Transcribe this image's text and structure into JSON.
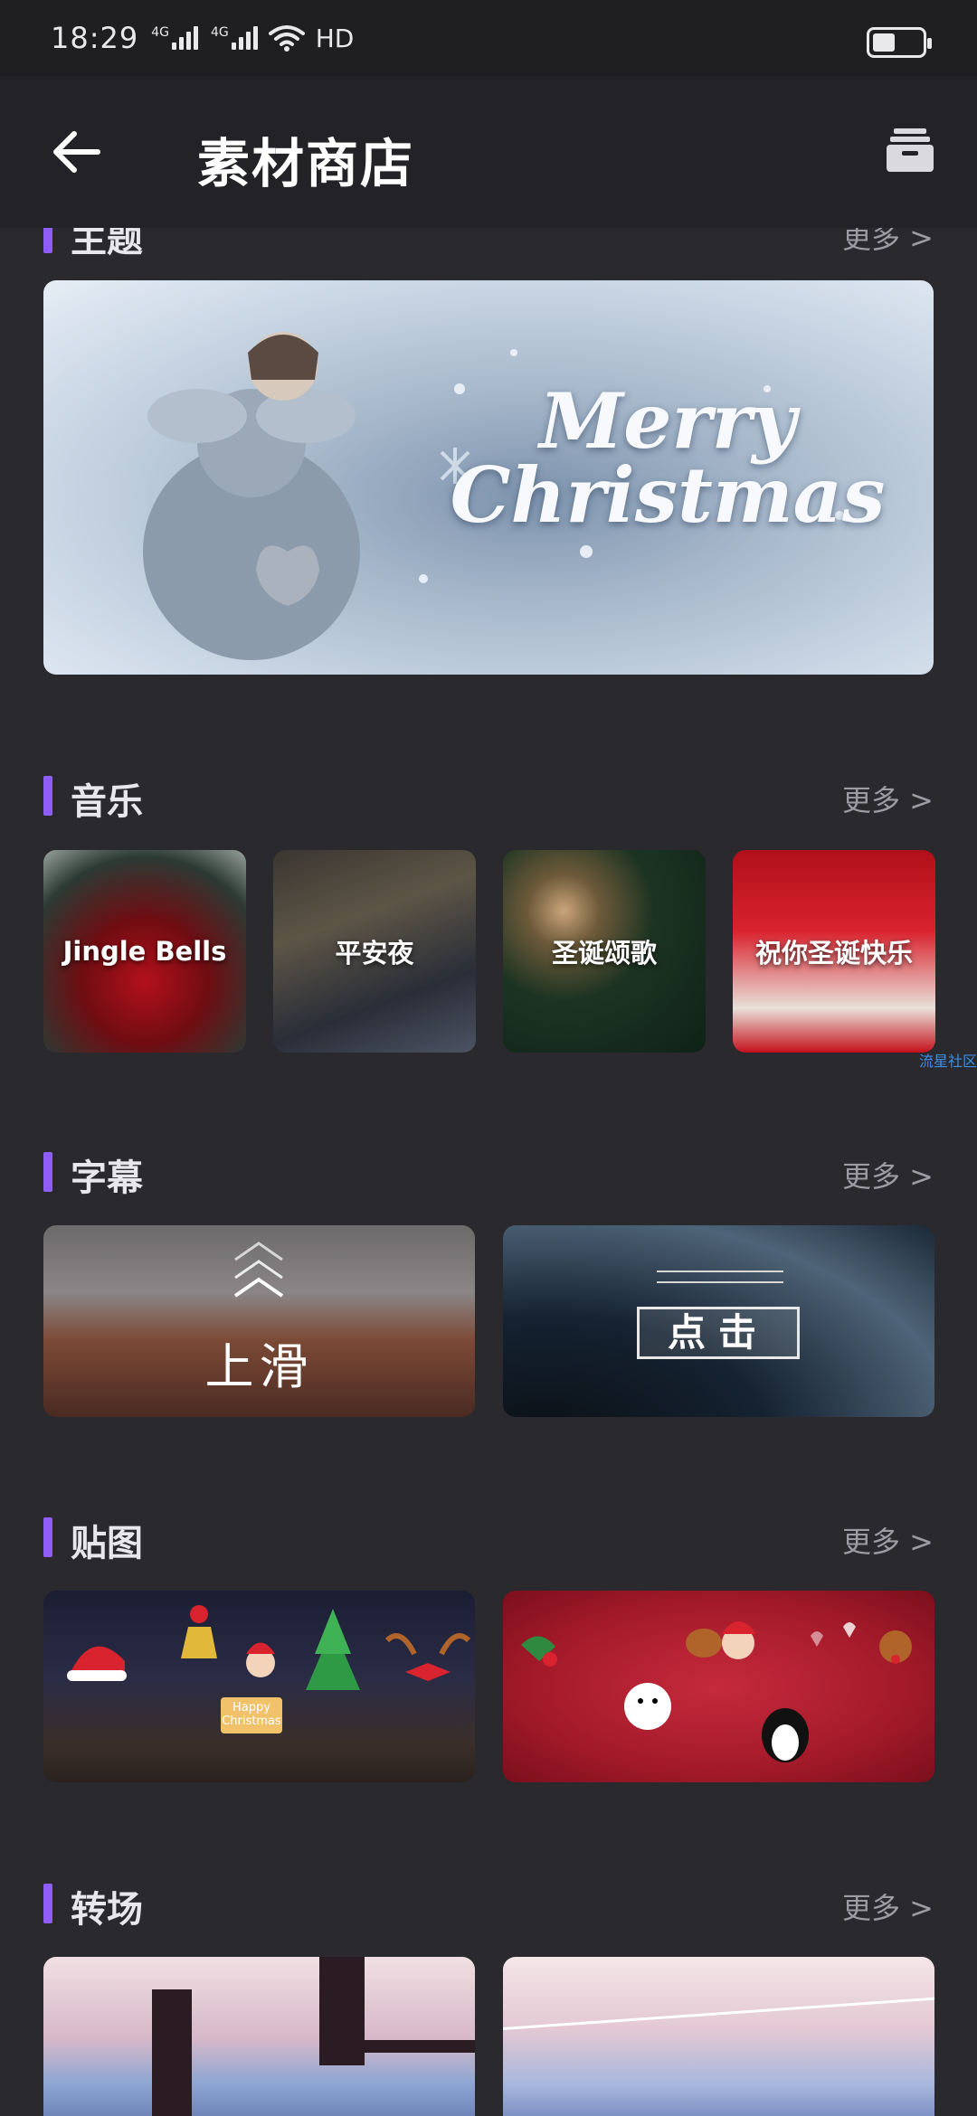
{
  "status_bar": {
    "time": "18:29",
    "network1": "4G",
    "network2": "4G",
    "hd": "HD",
    "battery_level": 0.45
  },
  "header": {
    "title": "素材商店"
  },
  "sections": {
    "theme": {
      "name": "主题",
      "more": "更多 >",
      "banner_title": "Merry Christmas"
    },
    "music": {
      "name": "音乐",
      "more": "更多 >",
      "items": [
        "Jingle Bells",
        "平安夜",
        "圣诞颂歌",
        "祝你圣诞快乐"
      ]
    },
    "subtitle": {
      "name": "字幕",
      "more": "更多 >",
      "items": [
        "上滑",
        "点击"
      ]
    },
    "sticker": {
      "name": "贴图",
      "more": "更多 >",
      "happy_text": "Happy Christmas"
    },
    "transition": {
      "name": "转场",
      "more": "更多 >"
    }
  },
  "watermark": "流星社区",
  "colors": {
    "accent": "#8f5cf5",
    "background": "#2a292d",
    "header": "#232226"
  }
}
